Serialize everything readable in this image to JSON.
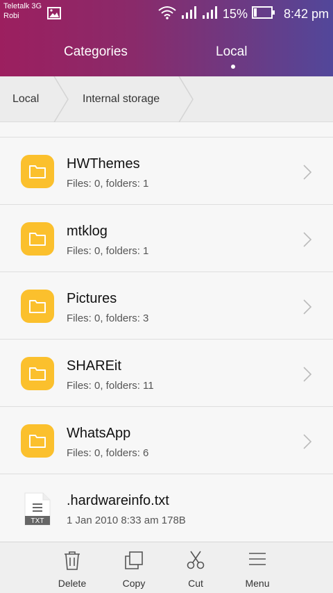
{
  "status_bar": {
    "carrier_line1": "Teletalk 3G",
    "carrier_line2": "Robi",
    "battery_percent": "15%",
    "time": "8:42 pm"
  },
  "tabs": [
    {
      "label": "Categories",
      "active": false
    },
    {
      "label": "Local",
      "active": true
    }
  ],
  "breadcrumb": [
    "Local",
    "Internal storage"
  ],
  "items": [
    {
      "type": "folder",
      "name": "HWThemes",
      "detail": "Files: 0, folders: 1"
    },
    {
      "type": "folder",
      "name": "mtklog",
      "detail": "Files: 0, folders: 1"
    },
    {
      "type": "folder",
      "name": "Pictures",
      "detail": "Files: 0, folders: 3"
    },
    {
      "type": "folder",
      "name": "SHAREit",
      "detail": "Files: 0, folders: 11"
    },
    {
      "type": "folder",
      "name": "WhatsApp",
      "detail": "Files: 0, folders: 6"
    },
    {
      "type": "file",
      "name": ".hardwareinfo.txt",
      "detail": "1 Jan 2010 8:33 am 178B",
      "badge": "TXT"
    }
  ],
  "toolbar": {
    "delete_label": "Delete",
    "copy_label": "Copy",
    "cut_label": "Cut",
    "menu_label": "Menu"
  },
  "colors": {
    "folder_accent": "#fbc02d",
    "header_start": "#9c1f5f",
    "header_end": "#52479a"
  }
}
